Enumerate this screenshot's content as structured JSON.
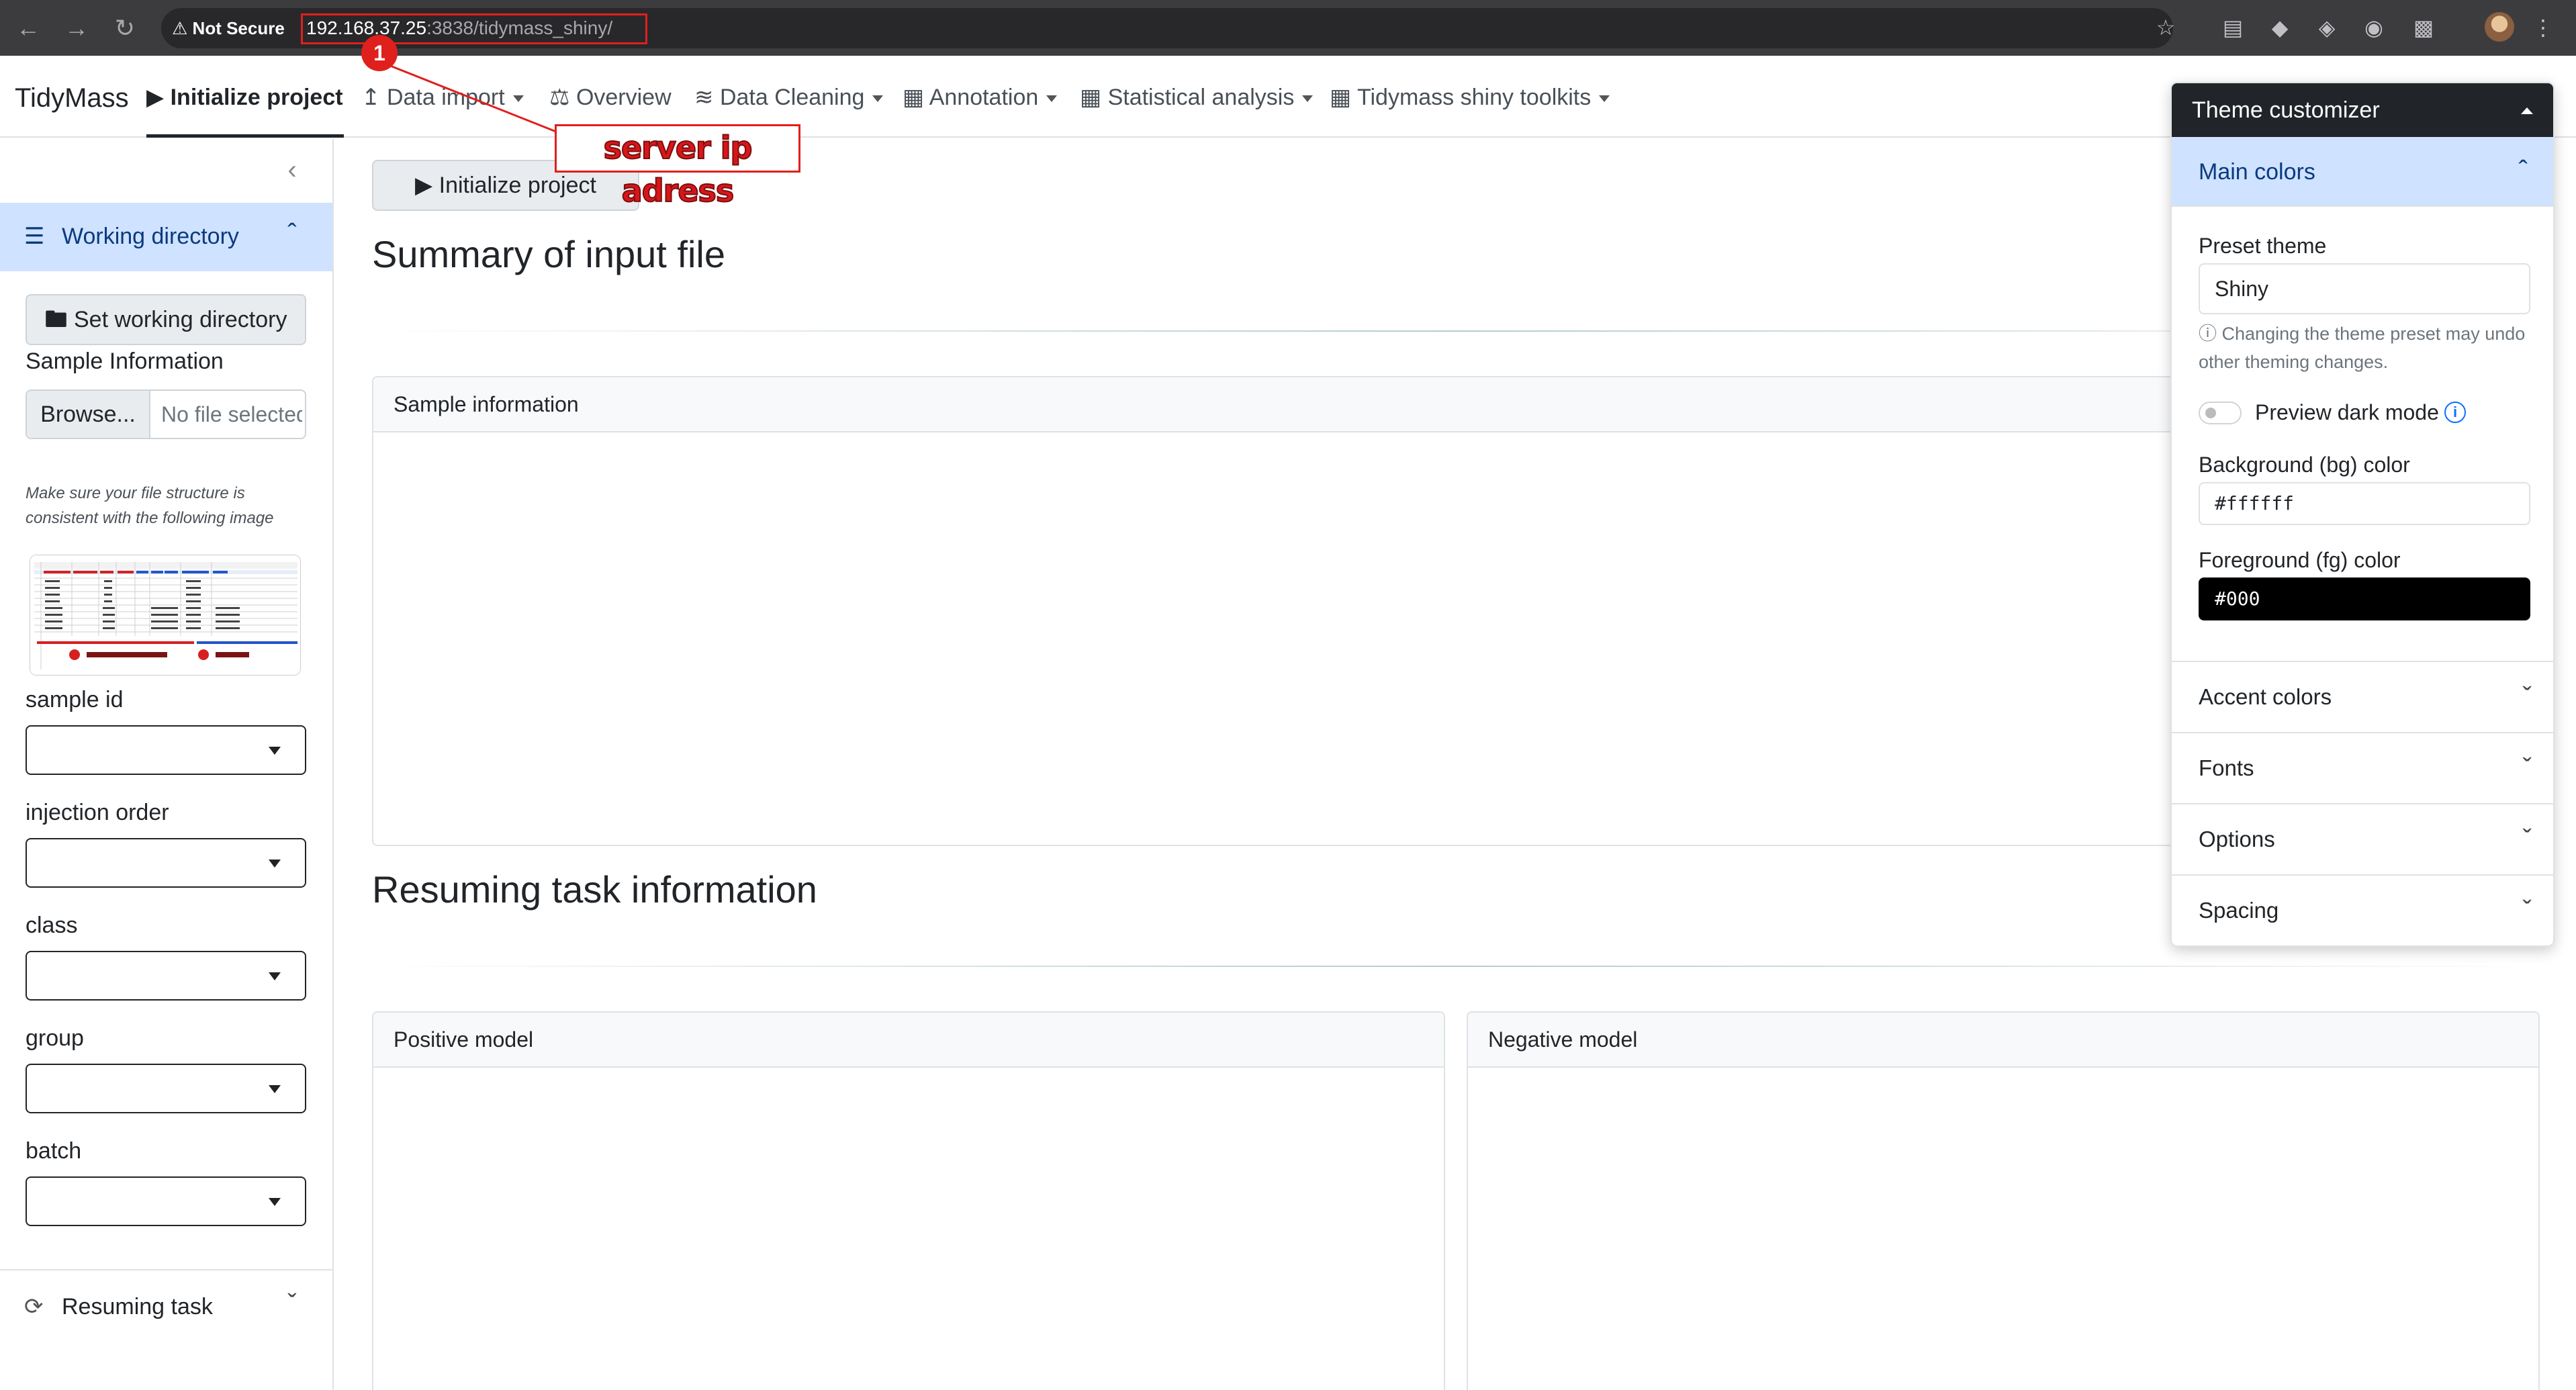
{
  "browser": {
    "security_label": "Not Secure",
    "url_host": "192.168.37.25",
    "url_rest": ":3838/tidymass_shiny/"
  },
  "annotation": {
    "badge": "1",
    "label": "server ip adress",
    "color": "#e0201c"
  },
  "navbar": {
    "brand": "TidyMass",
    "items": [
      {
        "label": "Initialize project",
        "icon": "play-circle-icon",
        "active": true
      },
      {
        "label": "Data import",
        "icon": "upload-icon",
        "dropdown": true
      },
      {
        "label": "Overview",
        "icon": "scale-icon"
      },
      {
        "label": "Data Cleaning",
        "icon": "broom-icon",
        "dropdown": true
      },
      {
        "label": "Annotation",
        "icon": "id-card-icon",
        "dropdown": true
      },
      {
        "label": "Statistical analysis",
        "icon": "id-card-icon",
        "dropdown": true
      },
      {
        "label": "Tidymass shiny toolkits",
        "icon": "id-card-icon",
        "dropdown": true
      }
    ]
  },
  "sidebar": {
    "working_dir_label": "Working directory",
    "set_wd_button": "Set working directory",
    "sample_info_label": "Sample Information",
    "browse_button": "Browse...",
    "file_placeholder": "No file selected",
    "hint": "Make sure your file structure is consistent with the following image",
    "thumb_notes": [
      "must have these columns",
      "options"
    ],
    "selects": [
      {
        "label": "sample id"
      },
      {
        "label": "injection order"
      },
      {
        "label": "class"
      },
      {
        "label": "group"
      },
      {
        "label": "batch"
      }
    ],
    "resuming_label": "Resuming task"
  },
  "main": {
    "init_button": "Initialize project",
    "summary_title": "Summary of input file",
    "sample_card_title": "Sample information",
    "resume_title": "Resuming task information",
    "positive_card_title": "Positive model",
    "negative_card_title": "Negative model"
  },
  "theme": {
    "title": "Theme customizer",
    "main_colors": "Main colors",
    "preset_label": "Preset theme",
    "preset_value": "Shiny",
    "preset_help": "Changing the theme preset may undo other theming changes.",
    "dark_mode_label": "Preview dark mode",
    "bg_label": "Background (bg) color",
    "bg_value": "#ffffff",
    "fg_label": "Foreground (fg) color",
    "fg_value": "#000",
    "sections": [
      "Accent colors",
      "Fonts",
      "Options",
      "Spacing"
    ]
  }
}
